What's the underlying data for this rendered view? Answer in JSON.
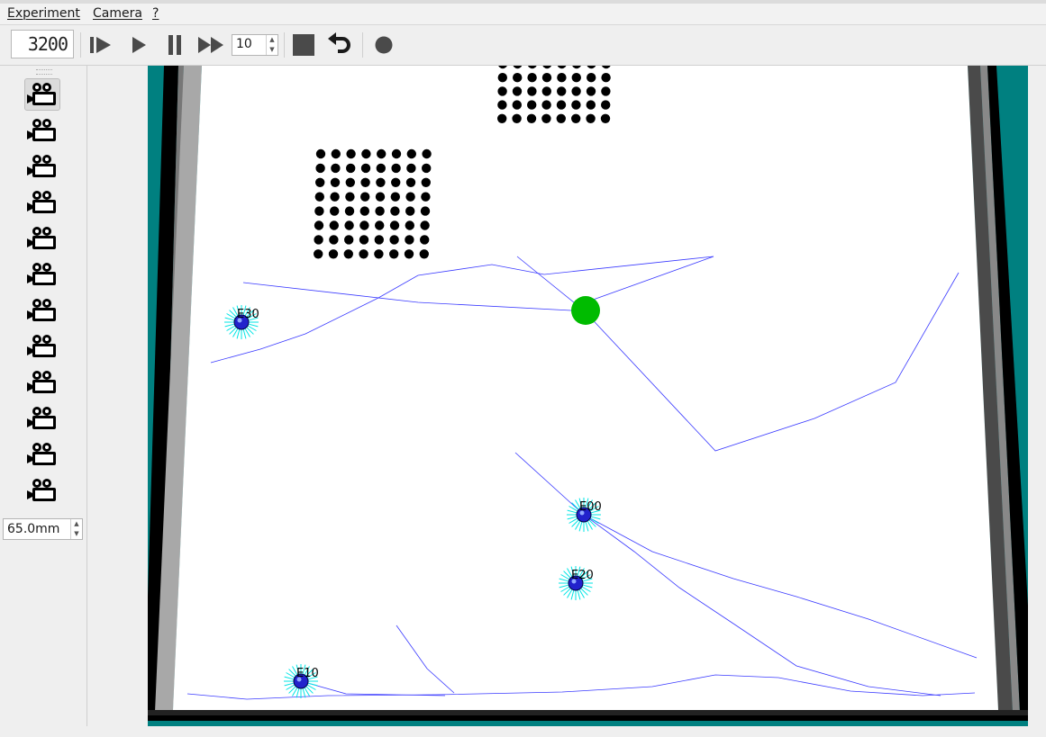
{
  "menu": {
    "experiment": "Experiment",
    "camera": "Camera",
    "help": "?"
  },
  "toolbar": {
    "counter": "3200",
    "speed_value": "10",
    "icons": [
      "step-forward-icon",
      "play-icon",
      "pause-icon",
      "fast-forward-icon",
      "stop-icon",
      "reset-icon",
      "record-icon"
    ]
  },
  "side_panel": {
    "camera_count": 12,
    "active_camera": 1,
    "distance": "65.0mm"
  },
  "arena": {
    "robots": [
      {
        "id": "E30"
      },
      {
        "id": "E00"
      },
      {
        "id": "E20"
      },
      {
        "id": "E10"
      }
    ],
    "colors": {
      "floor": "#ffffff",
      "wall_teal": "#008080",
      "trail": "#3a3aff",
      "light_source": "#00bb00",
      "robot_body": "#2222cc",
      "robot_halo": "#00e5e5"
    }
  }
}
